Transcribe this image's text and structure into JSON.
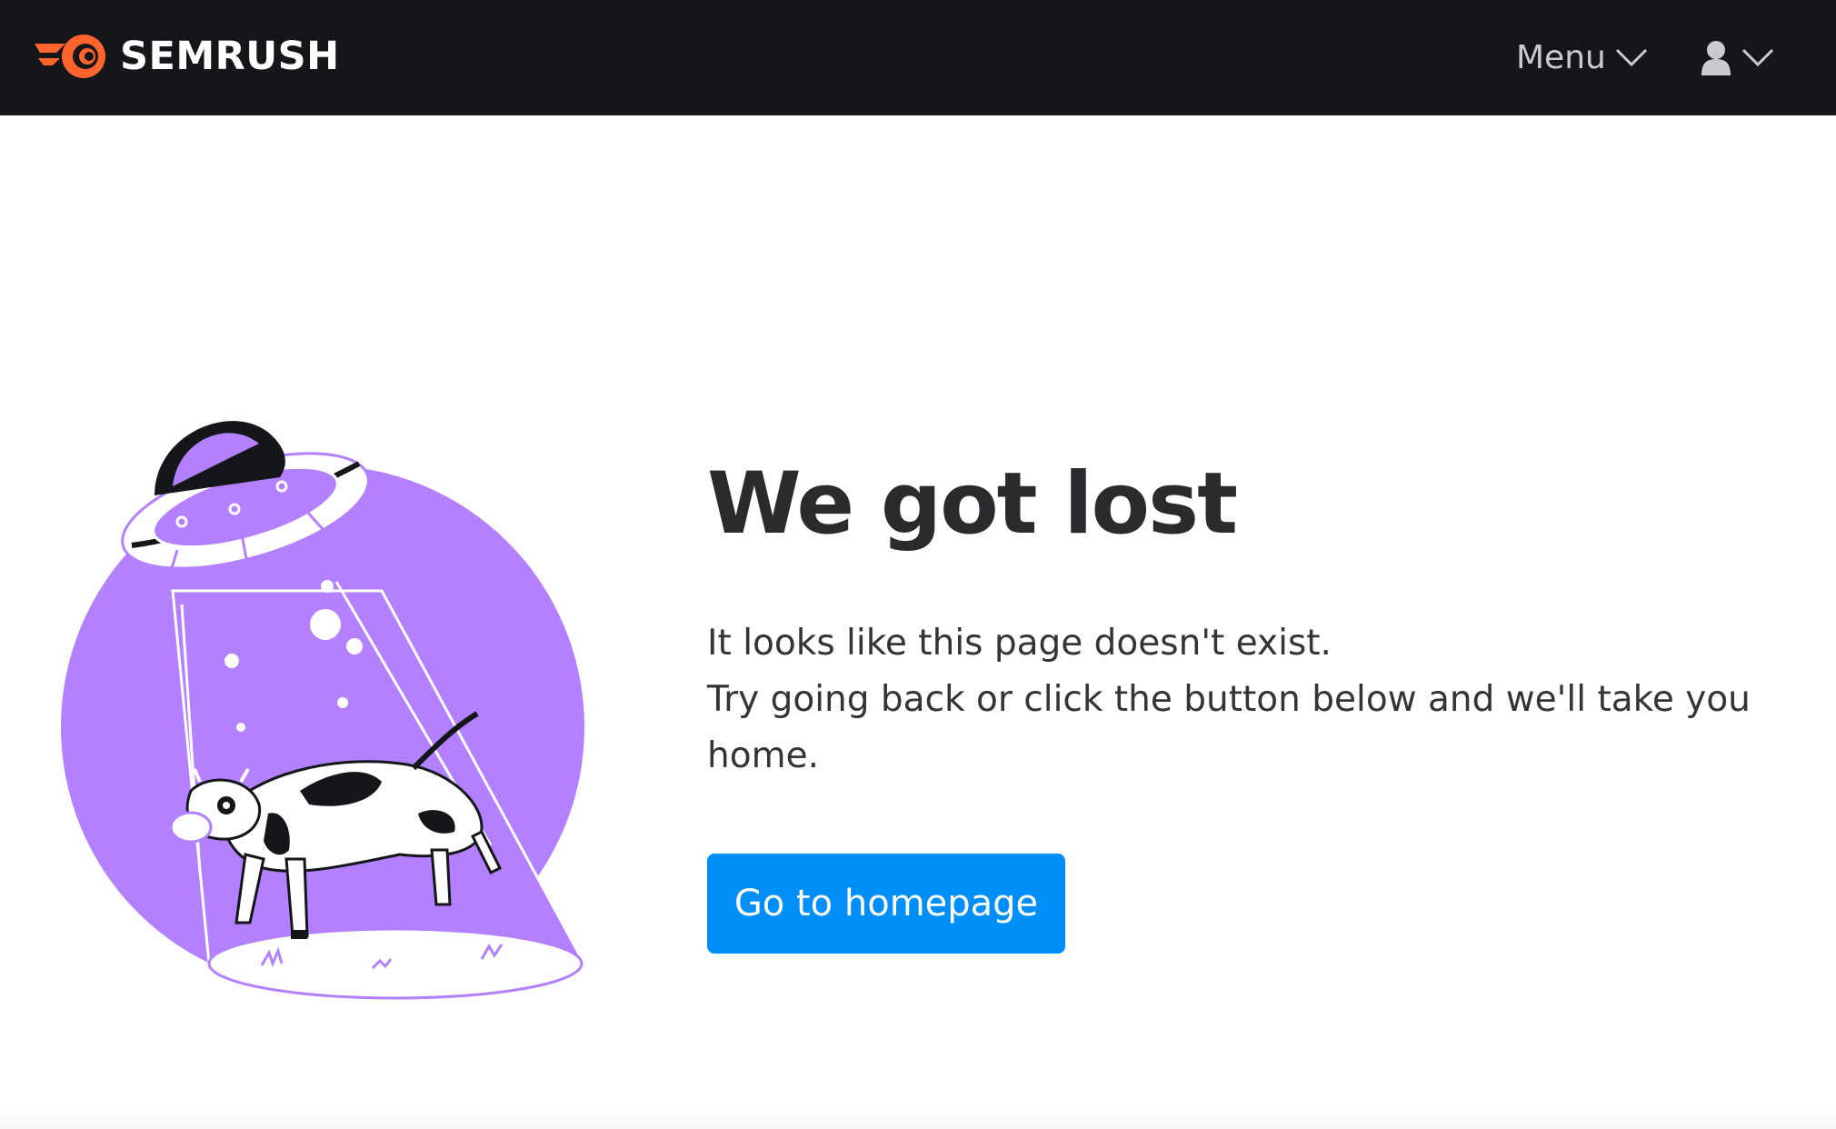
{
  "header": {
    "logo_text": "SEMRUSH",
    "menu_label": "Menu",
    "logo_icon": "semrush-flame-icon",
    "user_icon": "user-icon",
    "chevron_icon": "chevron-down-icon"
  },
  "main": {
    "heading": "We got lost",
    "body_line1": "It looks like this page doesn't exist.",
    "body_line2": "Try going back or click the button below and we'll take you home.",
    "cta_label": "Go to homepage"
  },
  "colors": {
    "header_bg": "#15161a",
    "brand_orange": "#ff642d",
    "cta_blue": "#008ff8",
    "illustration_purple": "#b380ff"
  }
}
